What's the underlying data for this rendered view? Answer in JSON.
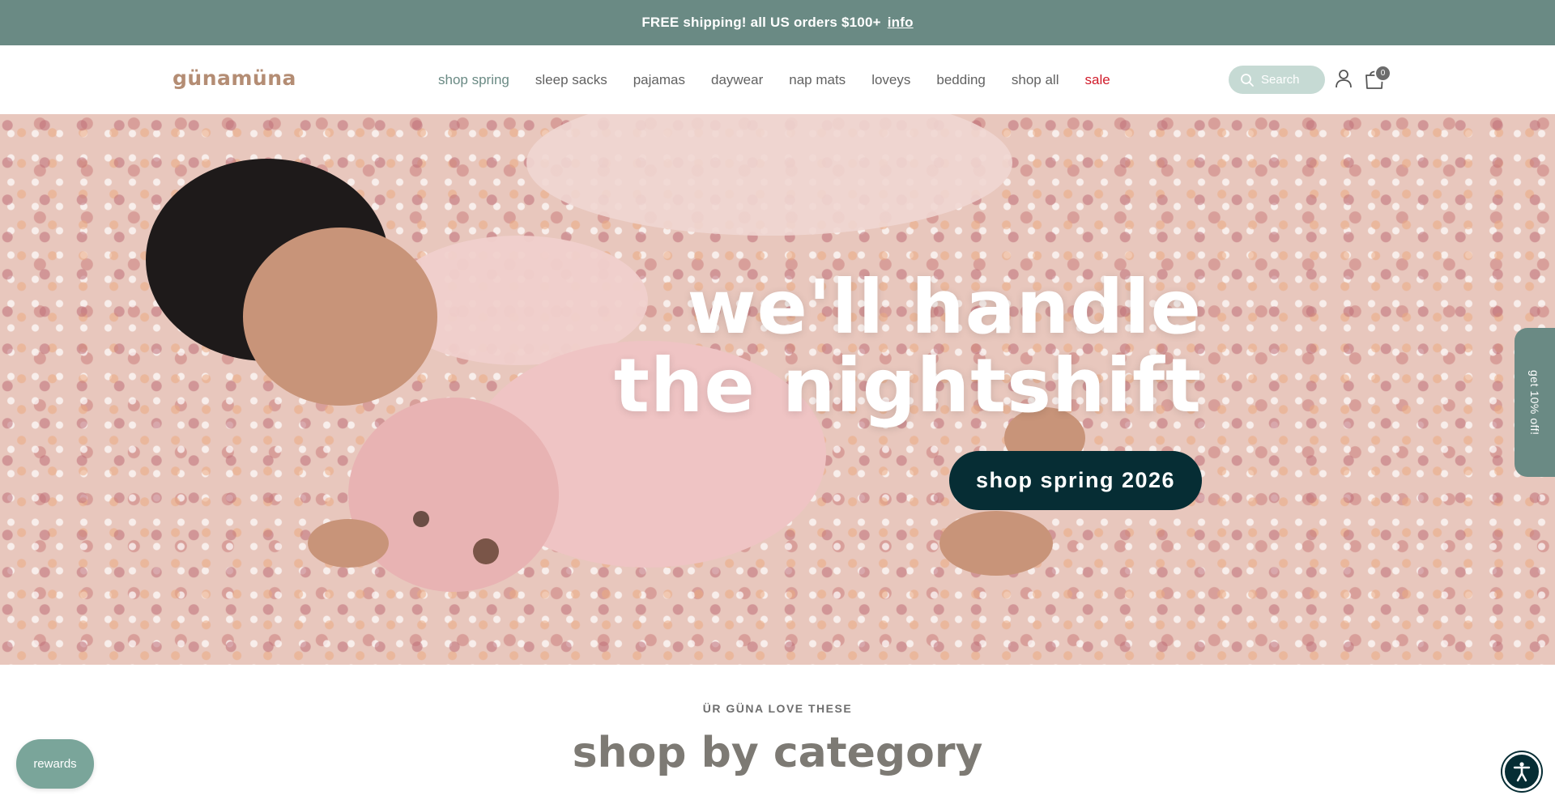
{
  "announcement": {
    "text": "FREE shipping! all US orders $100+",
    "link": "info"
  },
  "header": {
    "logo_text": "günamüna",
    "nav": [
      {
        "label": "shop spring"
      },
      {
        "label": "sleep sacks"
      },
      {
        "label": "pajamas"
      },
      {
        "label": "daywear"
      },
      {
        "label": "nap mats"
      },
      {
        "label": "loveys"
      },
      {
        "label": "bedding"
      },
      {
        "label": "shop all"
      },
      {
        "label": "sale"
      }
    ],
    "search_placeholder": "Search",
    "cart_count": "0"
  },
  "hero": {
    "title_line1": "we'll handle",
    "title_line2": "the nightshift",
    "cta": "shop spring 2026"
  },
  "side_tab": "get 10% off!",
  "category": {
    "eyebrow": "ÜR GÜNA LOVE THESE",
    "title": "shop by category"
  },
  "rewards_label": "rewards",
  "colors": {
    "announcement_bg": "#6a8a84",
    "sale": "#d01b2a",
    "cta_bg": "#062d34",
    "rewards_bg": "#7aa59a"
  },
  "icons": [
    "search-icon",
    "account-icon",
    "cart-icon",
    "accessibility-icon"
  ]
}
